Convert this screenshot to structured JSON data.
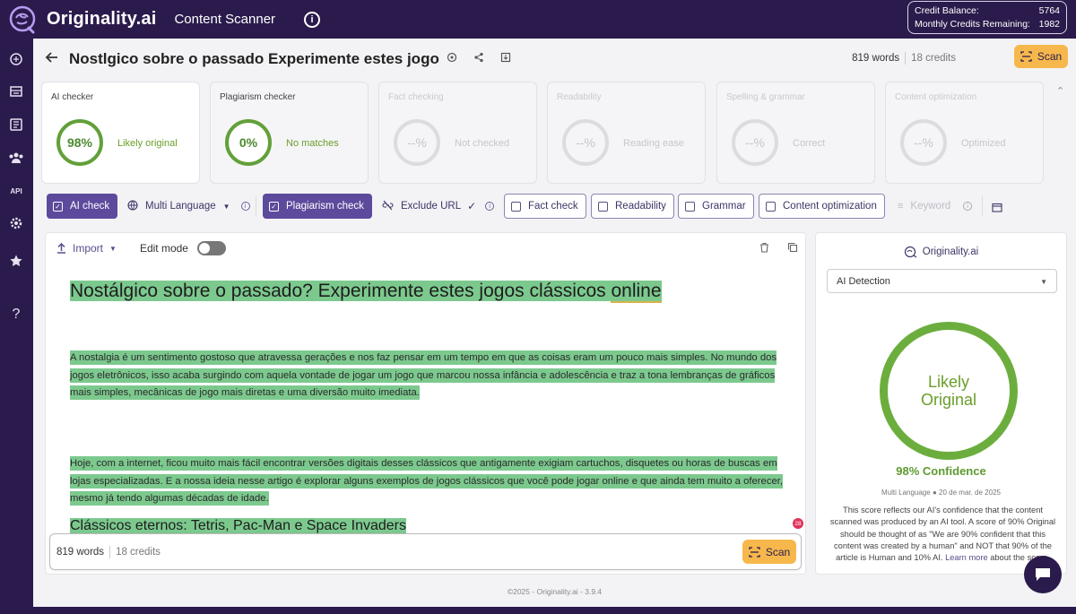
{
  "header": {
    "brand": "Originality.ai",
    "app_name": "Content Scanner",
    "info_icon": "i",
    "credit_balance_label": "Credit Balance:",
    "credit_balance_value": "5764",
    "monthly_label": "Monthly Credits Remaining:",
    "monthly_value": "1982"
  },
  "sidebar": {
    "items": [
      {
        "icon": "brain-icon"
      },
      {
        "icon": "document-stack-icon"
      },
      {
        "icon": "newspaper-icon"
      },
      {
        "icon": "team-icon"
      },
      {
        "label": "API"
      },
      {
        "icon": "gear-icon"
      },
      {
        "icon": "star-icon"
      },
      {
        "label": "?"
      }
    ]
  },
  "doc": {
    "title": "Nostlgico sobre o passado Experimente estes jogo",
    "words": "819 words",
    "credits": "18 credits",
    "scan_label": "Scan"
  },
  "cards": [
    {
      "title": "AI checker",
      "value": "98%",
      "status": "Likely original"
    },
    {
      "title": "Plagiarism checker",
      "value": "0%",
      "status": "No matches"
    },
    {
      "title": "Fact checking",
      "value": "--%",
      "status": "Not checked"
    },
    {
      "title": "Readability",
      "value": "--%",
      "status": "Reading ease"
    },
    {
      "title": "Spelling & grammar",
      "value": "--%",
      "status": "Correct"
    },
    {
      "title": "Content optimization",
      "value": "--%",
      "status": "Optimized"
    }
  ],
  "toolbar": {
    "ai_check": "AI check",
    "multi_language": "Multi Language",
    "plagiarism_check": "Plagiarism check",
    "exclude_url": "Exclude URL",
    "fact_check": "Fact check",
    "readability": "Readability",
    "grammar": "Grammar",
    "content_optimization": "Content optimization",
    "keyword": "Keyword"
  },
  "editor": {
    "import_label": "Import",
    "edit_mode_label": "Edit mode",
    "heading": "Nostálgico sobre o passado?  Experimente estes jogos clássicos ",
    "heading_underlined": "online",
    "para1": "A nostalgia é um sentimento gostoso que atravessa gerações e nos faz pensar em um tempo em que as coisas eram um pouco mais simples.  No mundo dos jogos eletrônicos, isso acaba surgindo com aquela vontade de jogar um jogo que marcou nossa infância e adolescência e traz a tona lembranças de gráficos mais simples, mecânicas de jogo mais diretas e uma diversão muito imediata.",
    "para2": "Hoje, com a internet, ficou muito mais fácil encontrar versões digitais desses clássicos que antigamente exigiam cartuchos, disquetes ou horas de buscas em lojas especializadas.  E a nossa ideia nesse artigo é explorar alguns exemplos de jogos clássicos que você pode jogar online e que ainda tem muito a oferecer, mesmo já tendo algumas décadas de idade.",
    "subheading": "Clássicos eternos: Tetris, Pac-Man e Space Invaders",
    "badge": "28",
    "bottom_words": "819 words",
    "bottom_credits": "18 credits",
    "bottom_scan": "Scan"
  },
  "result_panel": {
    "brand": "Originality.ai",
    "mode_select": "AI Detection",
    "ring_line1": "Likely",
    "ring_line2": "Original",
    "confidence": "98% Confidence",
    "meta_language": "Multi Language",
    "meta_date": "20 de mar. de 2025",
    "description": "This score reflects our AI's confidence that the content scanned was produced by an AI tool. A score of 90% Original should be thought of as \"We are 90% confident that this content was created by a human\" and NOT that 90% of the article is Human and 10% AI.",
    "learn_more": "Learn more",
    "learn_more_suffix": " about the score."
  },
  "footer": {
    "text": "©2025 - Originality.ai - 3.9.4"
  },
  "colors": {
    "brand_dark": "#2b1b4c",
    "accent_purple": "#5e4a9c",
    "scan_orange": "#f6b84c",
    "success_green": "#6cae3e",
    "highlight_green": "#7cc98e"
  }
}
